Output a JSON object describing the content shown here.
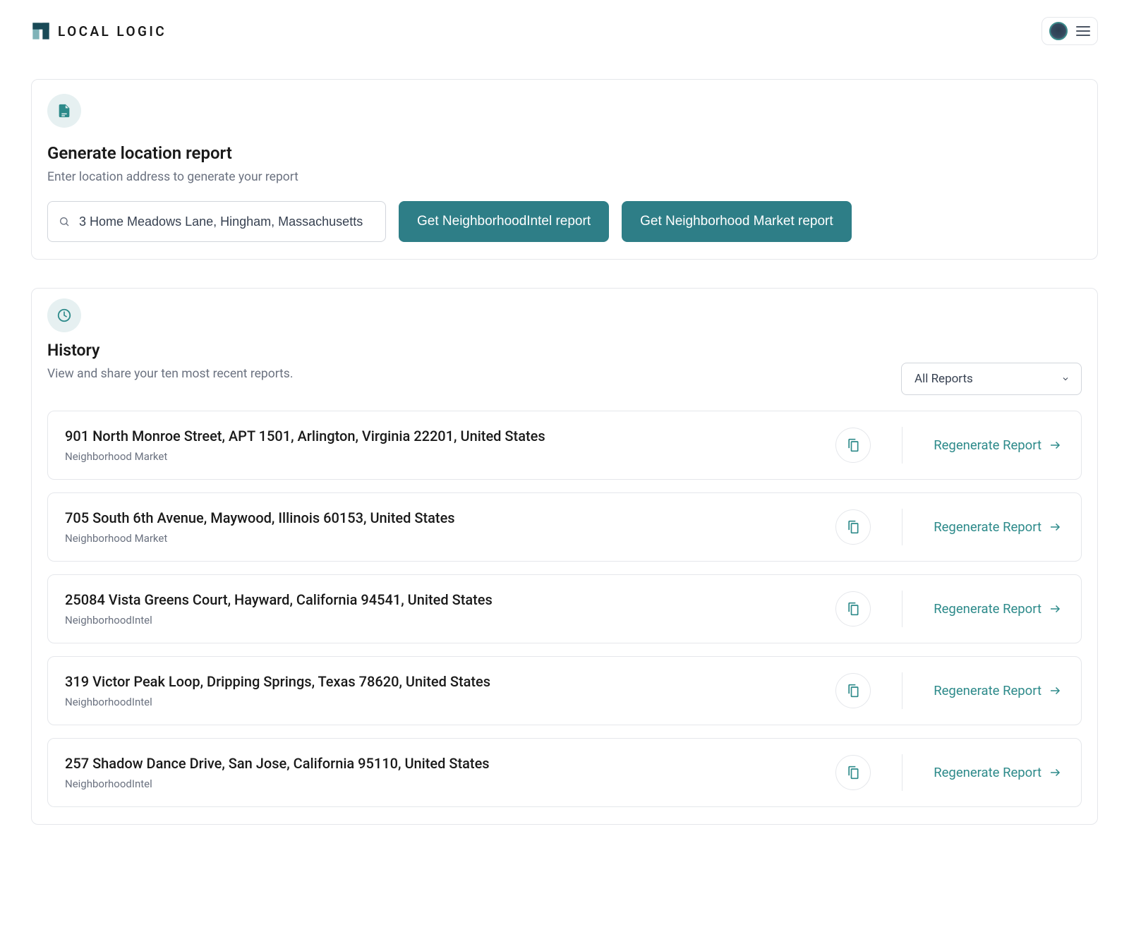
{
  "brand": {
    "name": "LOCAL LOGIC"
  },
  "generate": {
    "title": "Generate location report",
    "subtitle": "Enter location address to generate your report",
    "search_value": "3 Home Meadows Lane, Hingham, Massachusetts",
    "btn1": "Get NeighborhoodIntel report",
    "btn2": "Get Neighborhood Market report"
  },
  "history": {
    "title": "History",
    "subtitle": "View and share your ten most recent reports.",
    "filter_selected": "All Reports",
    "regen_label": "Regenerate Report",
    "items": [
      {
        "address": "901 North Monroe Street, APT 1501, Arlington, Virginia 22201, United States",
        "type": "Neighborhood Market"
      },
      {
        "address": "705 South 6th Avenue, Maywood, Illinois 60153, United States",
        "type": "Neighborhood Market"
      },
      {
        "address": "25084 Vista Greens Court, Hayward, California 94541, United States",
        "type": "NeighborhoodIntel"
      },
      {
        "address": "319 Victor Peak Loop, Dripping Springs, Texas 78620, United States",
        "type": "NeighborhoodIntel"
      },
      {
        "address": "257 Shadow Dance Drive, San Jose, California 95110, United States",
        "type": "NeighborhoodIntel"
      }
    ]
  },
  "colors": {
    "accent": "#2e7e87",
    "icon_bg": "#e6f0f1",
    "text_muted": "#6b7280"
  }
}
